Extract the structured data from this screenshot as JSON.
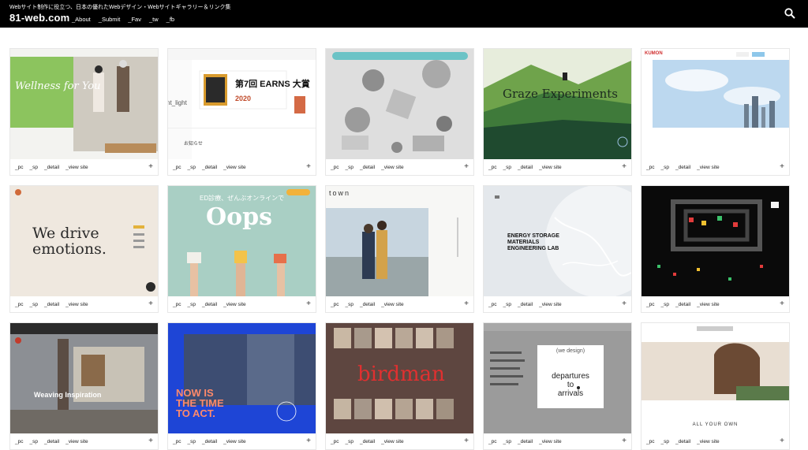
{
  "header": {
    "tagline": "Webサイト制作に役立つ、日本の優れたWebデザイン・Webサイトギャラリー＆リンク集",
    "logo": "81-web.com",
    "nav": [
      "_About",
      "_Submit",
      "_Fav",
      "_tw",
      "_fb"
    ]
  },
  "card_links": [
    "_pc",
    "_sp",
    "_detail",
    "_view site"
  ],
  "plus_label": "+",
  "cards": [
    {
      "id": "wellness",
      "texts": [
        "Wellness for You"
      ],
      "bg": "#7ec15b"
    },
    {
      "id": "print-award",
      "texts": [
        "第7回 EARNS 大賞",
        "2020",
        "nt_light",
        "お知らせ"
      ],
      "bg": "#f1f1f1"
    },
    {
      "id": "3d-shapes",
      "texts": [],
      "bg": "#d9d9d9"
    },
    {
      "id": "graze",
      "texts": [
        "Graze Experiments"
      ],
      "bg": "#2c6a3a"
    },
    {
      "id": "kumon",
      "texts": [
        "KUMON"
      ],
      "bg": "#bcd6ec"
    },
    {
      "id": "we-drive",
      "texts": [
        "We drive",
        "emotions."
      ],
      "bg": "#efe8df"
    },
    {
      "id": "oops",
      "texts": [
        "ED診療、ぜんぶオンラインで",
        "Oops"
      ],
      "bg": "#a9cfc4"
    },
    {
      "id": "town",
      "texts": [
        "town"
      ],
      "bg": "#f6f6f6"
    },
    {
      "id": "energy",
      "texts": [
        "ENERGY STORAGE",
        "MATERIALS",
        "ENGINEERING LAB"
      ],
      "bg": "#dfe3e8"
    },
    {
      "id": "pixel",
      "texts": [],
      "bg": "#0a0a0a"
    },
    {
      "id": "weaving",
      "texts": [
        "Weaving Inspiration"
      ],
      "bg": "#8a8f96"
    },
    {
      "id": "now-is-the-time",
      "texts": [
        "NOW IS",
        "THE TIME",
        "TO ACT."
      ],
      "bg": "#1e45d6"
    },
    {
      "id": "birdman",
      "texts": [
        "birdman"
      ],
      "bg": "#6a4b44"
    },
    {
      "id": "departures",
      "texts": [
        "(we design)",
        "departures",
        "to",
        "arrivals"
      ],
      "bg": "#9a9a9a"
    },
    {
      "id": "all-your-own",
      "texts": [
        "ALL YOUR OWN"
      ],
      "bg": "#f5f0ea"
    }
  ]
}
